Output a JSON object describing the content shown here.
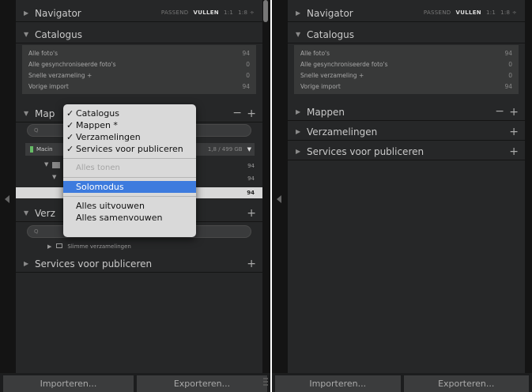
{
  "left": {
    "navigator": {
      "title": "Navigator",
      "opts": [
        "PASSEND",
        "VULLEN",
        "1:1",
        "1:8 ÷"
      ],
      "selected_index": 1
    },
    "catalogus": {
      "title": "Catalogus",
      "items": [
        {
          "label": "Alle foto's",
          "count": "94"
        },
        {
          "label": "Alle gesynchroniseerde foto's",
          "count": "0"
        },
        {
          "label": "Snelle verzameling +",
          "count": "0"
        },
        {
          "label": "Vorige import",
          "count": "94"
        }
      ]
    },
    "mappen": {
      "title": "Map",
      "search_placeholder": "Q",
      "volume_name": "Macin",
      "volume_size": "1,8 / 499 GB",
      "rows": [
        {
          "count": "94"
        },
        {
          "count": "94"
        },
        {
          "count": "94"
        }
      ]
    },
    "verzamelingen": {
      "title": "Verz",
      "search_placeholder": "Q",
      "smart": "Slimme verzamelingen"
    },
    "services": {
      "title": "Services voor publiceren"
    },
    "menu": {
      "items_checked": [
        "Catalogus",
        "Mappen *",
        "Verzamelingen",
        "Services voor publiceren"
      ],
      "show_all": "Alles tonen",
      "solo": "Solomodus",
      "expand_all": "Alles uitvouwen",
      "collapse_all": "Alles samenvouwen"
    },
    "buttons": {
      "import": "Importeren...",
      "export": "Exporteren..."
    }
  },
  "right": {
    "navigator": {
      "title": "Navigator",
      "opts": [
        "PASSEND",
        "VULLEN",
        "1:1",
        "1:8 ÷"
      ],
      "selected_index": 1
    },
    "catalogus": {
      "title": "Catalogus",
      "items": [
        {
          "label": "Alle foto's",
          "count": "94"
        },
        {
          "label": "Alle gesynchroniseerde foto's",
          "count": "0"
        },
        {
          "label": "Snelle verzameling +",
          "count": "0"
        },
        {
          "label": "Vorige import",
          "count": "94"
        }
      ]
    },
    "sections": [
      "Mappen",
      "Verzamelingen",
      "Services voor publiceren"
    ],
    "buttons": {
      "import": "Importeren...",
      "export": "Exporteren..."
    }
  },
  "colors": {
    "panel": "#262728",
    "highlight": "#3d7bde",
    "menu": "#d9d9d9"
  }
}
